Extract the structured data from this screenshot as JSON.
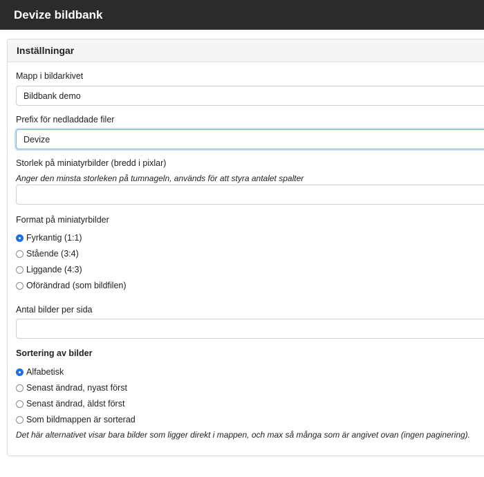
{
  "app": {
    "title": "Devize bildbank"
  },
  "panel": {
    "title": "Inställningar"
  },
  "folder": {
    "label": "Mapp i bildarkivet",
    "value": "Bildbank demo"
  },
  "prefix": {
    "label": "Prefix för nedladdade filer",
    "value": "Devize"
  },
  "thumb_size": {
    "label": "Storlek på miniatyrbilder (bredd i pixlar)",
    "help": "Anger den minsta storleken på tumnageln, används för att styra antalet spalter",
    "value": ""
  },
  "thumb_format": {
    "label": "Format på miniatyrbilder",
    "options": [
      {
        "label": "Fyrkantig (1:1)",
        "checked": true
      },
      {
        "label": "Stående (3:4)",
        "checked": false
      },
      {
        "label": "Liggande (4:3)",
        "checked": false
      },
      {
        "label": "Oförändrad (som bildfilen)",
        "checked": false
      }
    ]
  },
  "per_page": {
    "label": "Antal bilder per sida",
    "value": ""
  },
  "sorting": {
    "label": "Sortering av bilder",
    "options": [
      {
        "label": "Alfabetisk",
        "checked": true
      },
      {
        "label": "Senast ändrad, nyast först",
        "checked": false
      },
      {
        "label": "Senast ändrad, äldst först",
        "checked": false
      },
      {
        "label": "Som bildmappen är sorterad",
        "checked": false
      }
    ],
    "help": "Det här alternativet visar bara bilder som ligger direkt i mappen, och max så många som är angivet ovan (ingen paginering)."
  },
  "colors": {
    "topbar": "#2b2b2b",
    "accent": "#1f6fe5",
    "focus": "#7fb5ef"
  }
}
